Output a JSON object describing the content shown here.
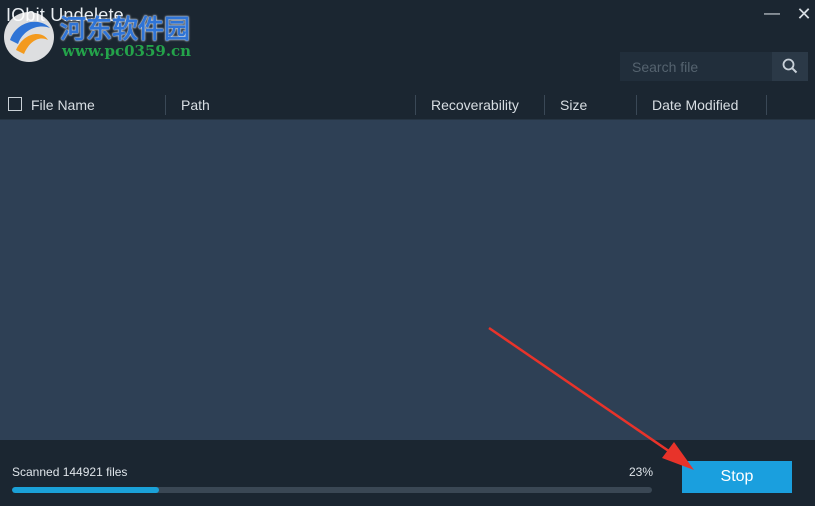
{
  "window": {
    "title": "IObit Undelete",
    "minimize_glyph": "—",
    "close_glyph": "✕"
  },
  "watermark": {
    "site_name": "河东软件园",
    "url": "www.pc0359.cn"
  },
  "search": {
    "placeholder": "Search file",
    "value": "",
    "icon": "search-icon"
  },
  "table": {
    "columns": [
      "File Name",
      "Path",
      "Recoverability",
      "Size",
      "Date Modified"
    ],
    "rows": []
  },
  "status": {
    "scanned_text": "Scanned 144921 files",
    "percent_text": "23%",
    "progress": 0.23
  },
  "actions": {
    "stop_label": "Stop"
  },
  "colors": {
    "accent": "#1a9fde",
    "background": "#1b2631",
    "list_background": "#2e4055",
    "annotation_arrow": "#e8332a"
  }
}
